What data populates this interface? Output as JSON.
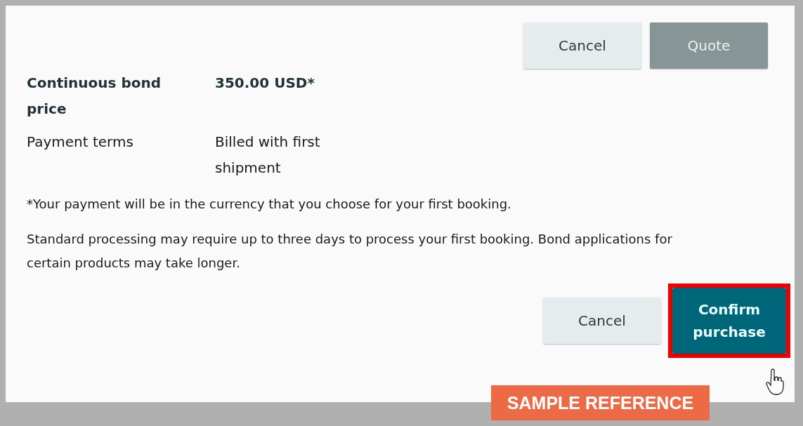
{
  "top_buttons": [
    {
      "label": "Cancel",
      "kind": "secondary",
      "disabled": false
    },
    {
      "label": "Quote",
      "kind": "primary",
      "disabled": true
    }
  ],
  "details": [
    {
      "label": "Continuous bond price",
      "value": "350.00 USD*",
      "emphasis": true
    },
    {
      "label": "Payment terms",
      "value": "Billed with first shipment",
      "emphasis": false
    }
  ],
  "notes": [
    "*Your payment will be in the currency that you choose for your first booking.",
    "Standard processing may require up to three days to process your first booking. Bond applications for certain products may take longer."
  ],
  "bottom_buttons": [
    {
      "label": "Cancel",
      "kind": "secondary",
      "disabled": false,
      "highlighted": false
    },
    {
      "label": "Confirm purchase",
      "kind": "primary",
      "disabled": false,
      "highlighted": true
    }
  ],
  "annotation": {
    "label": "SAMPLE REFERENCE"
  }
}
